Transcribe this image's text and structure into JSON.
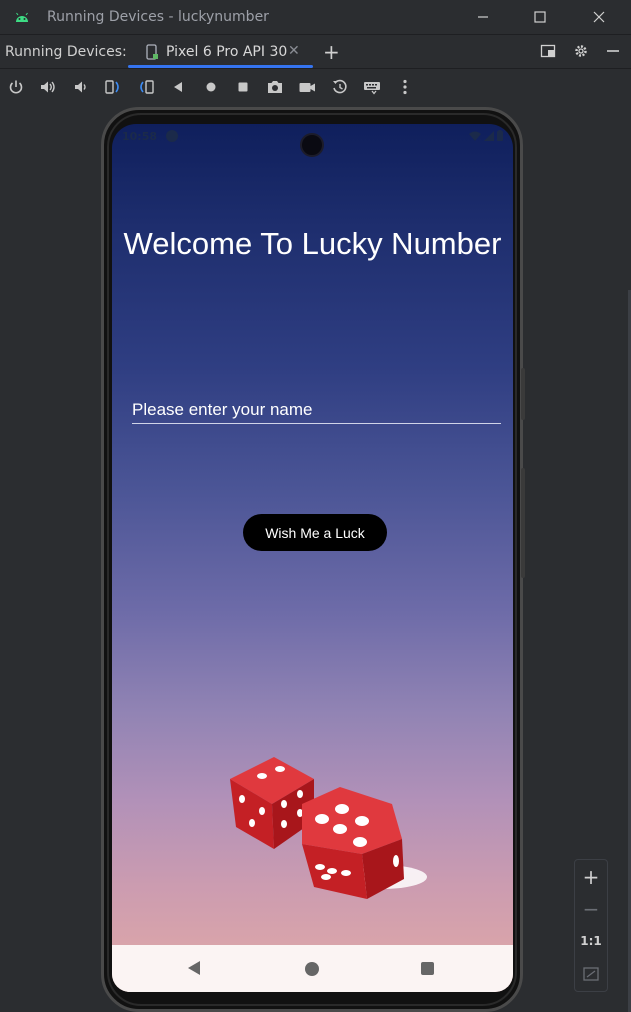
{
  "window": {
    "title": "Running Devices - luckynumber"
  },
  "tool_window": {
    "label": "Running Devices:",
    "tabs": [
      {
        "label": "Pixel 6 Pro API 30",
        "active": true,
        "icon": "device-icon"
      }
    ],
    "accent_color": "#3574f0"
  },
  "toolbar": {
    "icons": [
      "power-icon",
      "volume-up-icon",
      "volume-down-icon",
      "rotate-left-icon",
      "rotate-right-icon",
      "back-icon",
      "home-icon",
      "overview-icon",
      "screenshot-icon",
      "screen-record-icon",
      "snapshot-icon",
      "keyboard-icon",
      "more-icon"
    ]
  },
  "device": {
    "status": {
      "time": "10:58"
    },
    "app": {
      "welcome": "Welcome To Lucky Number",
      "name_placeholder": "Please enter your name",
      "button_label": "Wish Me a Luck"
    }
  },
  "zoom": {
    "in": "+",
    "out": "−",
    "ratio": "1:1"
  }
}
